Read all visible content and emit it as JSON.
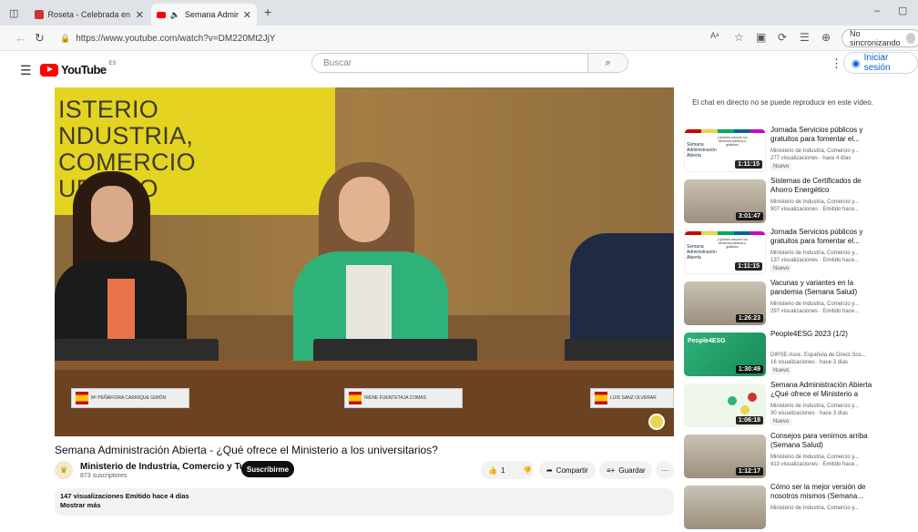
{
  "browser": {
    "tabs": [
      {
        "title": "Roseta - Celebrada en el Ministe",
        "active": false
      },
      {
        "title": "Semana Administración Abi",
        "active": true
      }
    ],
    "new_tab": "+",
    "url": "https://www.youtube.com/watch?v=DM220Mt2JjY",
    "sync_label": "No sincronizando"
  },
  "youtube": {
    "logo_text": "YouTube",
    "country_code": "ES",
    "search_placeholder": "Buscar",
    "signin_label": "Iniciar sesión"
  },
  "video": {
    "sign_lines": [
      "ISTERIO",
      "NDUSTRIA, COMERCIO",
      "URISMO"
    ],
    "nameplates": [
      "Mª PEÑAFIORA CARRIQUE GIMÓN",
      "IRENE FUENTETAJA COMAS",
      "LUIS SANZ OLVERAR"
    ],
    "title": "Semana Administración Abierta - ¿Qué ofrece el Ministerio a los universitarios?",
    "channel_name": "Ministerio de Industria, Comercio y Turismo",
    "subscribers": "873 suscriptores",
    "subscribe_label": "Suscribirme",
    "like_count": "1",
    "share_label": "Compartir",
    "save_label": "Guardar",
    "description_meta": "147 visualizaciones  Emitido hace 4 días",
    "show_more": "Mostrar más"
  },
  "sidebar": {
    "chat_message": "El chat en directo no se puede reproducir en este vídeo.",
    "recommendations": [
      {
        "title": "Jornada Servicios públicos y gratuitos para fomentar el...",
        "channel": "Ministerio de Industria, Comercio y...",
        "meta": "277 visualizaciones  ·  hace 4 días",
        "badge": "Nuevo",
        "duration": "1:11:15",
        "thumb": "white"
      },
      {
        "title": "Sistemas de Certificados de Ahorro Energético",
        "channel": "Ministerio de Industria, Comercio y...",
        "meta": "907 visualizaciones  ·  Emitido hace...",
        "badge": "",
        "duration": "3:01:47",
        "thumb": "room"
      },
      {
        "title": "Jornada Servicios públicos y gratuitos para fomentar el...",
        "channel": "Ministerio de Industria, Comercio y...",
        "meta": "137 visualizaciones  ·  Emitido hace...",
        "badge": "Nuevo",
        "duration": "1:11:15",
        "thumb": "white"
      },
      {
        "title": "Vacunas y variantes en la pandemia (Semana Salud)",
        "channel": "Ministerio de Industria, Comercio y...",
        "meta": "297 visualizaciones  ·  Emitido hace...",
        "badge": "",
        "duration": "1:26:23",
        "thumb": "room"
      },
      {
        "title": "People4ESG 2023 (1/2)",
        "channel": "DIRSE-Asoc. Española de Direct.Sos...",
        "meta": "16 visualizaciones  ·  hace 3 días",
        "badge": "Nuevo",
        "duration": "1:30:49",
        "thumb": "people"
      },
      {
        "title": "Semana Administración Abierta ¿Qué ofrece el Ministerio a los...",
        "channel": "Ministerio de Industria, Comercio y...",
        "meta": "30 visualizaciones  ·  hace 3 días",
        "badge": "Nuevo",
        "duration": "1:06:18",
        "thumb": "green"
      },
      {
        "title": "Consejos para venirnos arriba (Semana Salud)",
        "channel": "Ministerio de Industria, Comercio y...",
        "meta": "413 visualizaciones  ·  Emitido hace...",
        "badge": "",
        "duration": "1:12:17",
        "thumb": "room"
      },
      {
        "title": "Cómo ser la mejor versión de nosotros mismos (Semana...",
        "channel": "Ministerio de Industria, Comercio y...",
        "meta": "",
        "badge": "",
        "duration": "",
        "thumb": "room"
      }
    ]
  },
  "colors": {
    "youtube_red": "#ff0000",
    "link_blue": "#065fd4",
    "sign_yellow": "#e4d321"
  }
}
